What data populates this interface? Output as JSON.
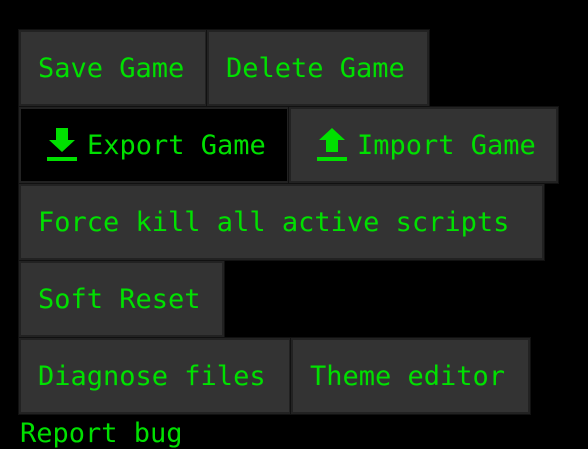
{
  "colors": {
    "text": "#00e000",
    "button_bg": "#333333",
    "button_active_bg": "#000000",
    "page_bg": "#000000"
  },
  "buttons": {
    "save_game": "Save Game",
    "delete_game": "Delete Game",
    "export_game": "Export Game",
    "import_game": "Import Game",
    "force_kill": "Force kill all active scripts",
    "soft_reset": "Soft Reset",
    "diagnose_files": "Diagnose files",
    "theme_editor": "Theme editor"
  },
  "icons": {
    "export": "download-icon",
    "import": "upload-icon"
  },
  "links": {
    "report_bug": "Report bug"
  }
}
